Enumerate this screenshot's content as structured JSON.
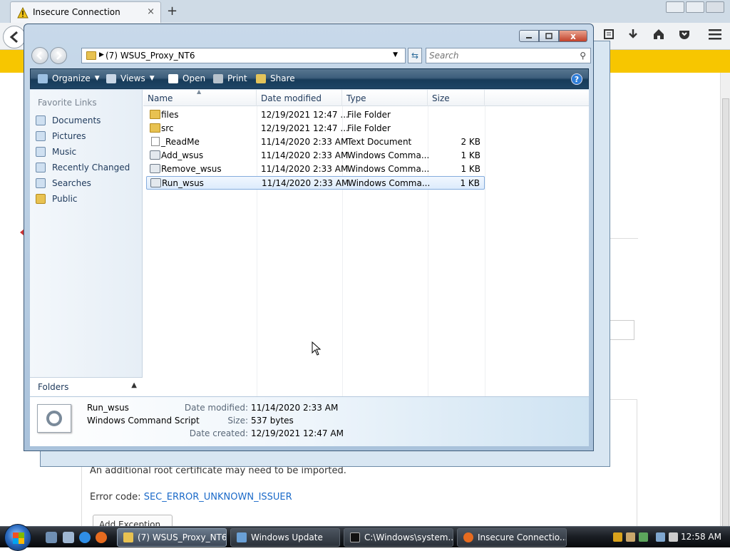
{
  "firefox": {
    "tab_title": "Insecure Connection",
    "tab_close": "×",
    "new_tab": "+",
    "error_line1": "An additional root certificate may need to be imported.",
    "error_code_label": "Error code: ",
    "error_code": "SEC_ERROR_UNKNOWN_ISSUER",
    "add_exception": "Add Exception..."
  },
  "explorer": {
    "close_glyph": "x",
    "breadcrumb": "(7) WSUS_Proxy_NT6",
    "search_placeholder": "Search",
    "commands": {
      "organize": "Organize",
      "views": "Views",
      "open": "Open",
      "print": "Print",
      "share": "Share",
      "help": "?"
    },
    "nav": {
      "favorite_links_title": "Favorite Links",
      "items": [
        {
          "label": "Documents",
          "icon": "documents-icon"
        },
        {
          "label": "Pictures",
          "icon": "pictures-icon"
        },
        {
          "label": "Music",
          "icon": "music-icon"
        },
        {
          "label": "Recently Changed",
          "icon": "recent-icon"
        },
        {
          "label": "Searches",
          "icon": "searches-icon"
        },
        {
          "label": "Public",
          "icon": "public-folder-icon"
        }
      ],
      "folders_label": "Folders",
      "folders_chevron": "▲"
    },
    "columns": {
      "name": "Name",
      "date_modified": "Date modified",
      "type": "Type",
      "size": "Size"
    },
    "files": [
      {
        "name": "files",
        "date": "12/19/2021 12:47 ...",
        "type": "File Folder",
        "size": "",
        "icon": "folder"
      },
      {
        "name": "src",
        "date": "12/19/2021 12:47 ...",
        "type": "File Folder",
        "size": "",
        "icon": "folder"
      },
      {
        "name": "_ReadMe",
        "date": "11/14/2020 2:33 AM",
        "type": "Text Document",
        "size": "2 KB",
        "icon": "doc"
      },
      {
        "name": "Add_wsus",
        "date": "11/14/2020 2:33 AM",
        "type": "Windows Comma...",
        "size": "1 KB",
        "icon": "cmd"
      },
      {
        "name": "Remove_wsus",
        "date": "11/14/2020 2:33 AM",
        "type": "Windows Comma...",
        "size": "1 KB",
        "icon": "cmd"
      },
      {
        "name": "Run_wsus",
        "date": "11/14/2020 2:33 AM",
        "type": "Windows Comma...",
        "size": "1 KB",
        "icon": "cmd",
        "selected": true
      }
    ],
    "details": {
      "name": "Run_wsus",
      "type": "Windows Command Script",
      "date_modified_label": "Date modified:",
      "date_modified": "11/14/2020 2:33 AM",
      "size_label": "Size:",
      "size": "537 bytes",
      "date_created_label": "Date created:",
      "date_created": "12/19/2021 12:47 AM"
    }
  },
  "taskbar": {
    "buttons": [
      {
        "label": "(7) WSUS_Proxy_NT6",
        "active": true
      },
      {
        "label": "Windows Update",
        "active": false
      },
      {
        "label": "C:\\Windows\\system...",
        "active": false
      },
      {
        "label": "Insecure Connectio...",
        "active": false
      }
    ],
    "clock": "12:58 AM"
  }
}
